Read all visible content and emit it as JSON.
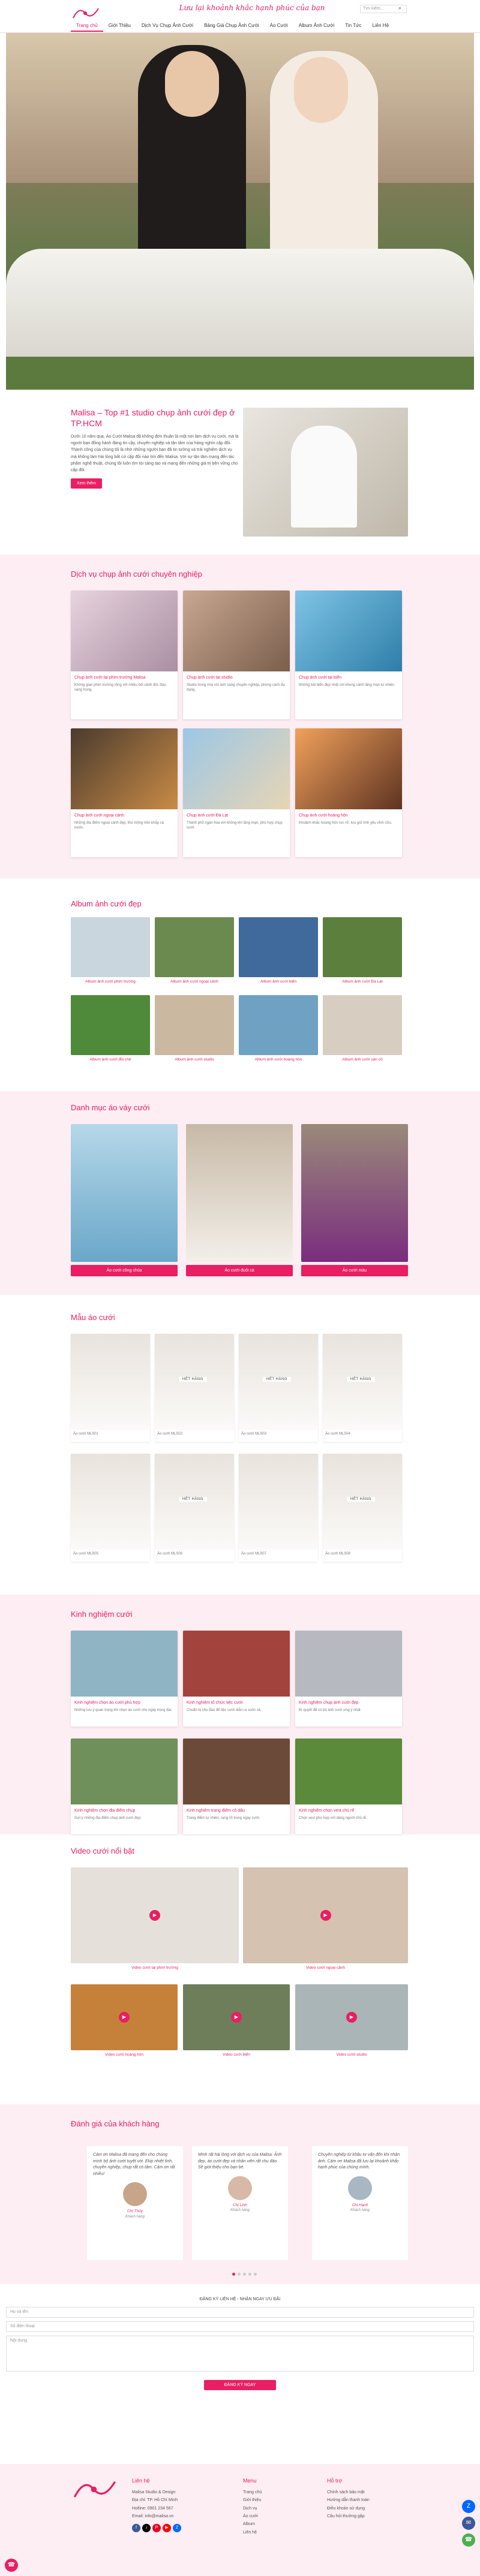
{
  "header": {
    "logo_text": "Malisa",
    "slogan": "Lưu lại khoảnh khắc hạnh phúc của bạn",
    "search_placeholder": "Tìm kiếm...",
    "nav": [
      "Trang chủ",
      "Giới Thiệu",
      "Dịch Vụ Chụp Ảnh Cưới",
      "Bảng Giá Chụp Ảnh Cưới",
      "Áo Cưới",
      "Album Ảnh Cưới",
      "Tin Tức",
      "Liên Hệ"
    ]
  },
  "intro": {
    "title": "Malisa – Top #1 studio chụp ảnh cưới đẹp ở TP.HCM",
    "text": "Dưới 10 năm qua, Áo Cưới Malisa đã không đơn thuần là một nơi làm dịch vụ cưới, mà là người bạn đồng hành đáng tin cậy, chuyên nghiệp và tận tâm của hàng nghìn cặp đôi. Thành công của chúng tôi là nhờ những người bạn đã tin tưởng và trải nghiệm dịch vụ mà không làm hài lòng bất cứ cặp đôi nào tìm đến Malisa. Với sự tận tâm mang đến tác phẩm nghệ thuật, chúng tôi luôn tìm tòi sáng tạo và mang đến những giá trị bền vững cho cặp đôi.",
    "button": "Xem thêm"
  },
  "services": {
    "title": "Dịch vụ chụp ảnh cưới chuyên nghiệp",
    "items": [
      {
        "title": "Chụp ảnh cưới tại phim trường Malisa",
        "desc": "Không gian phim trường rộng với nhiều bối cảnh độc đáo, sang trọng."
      },
      {
        "title": "Chụp ảnh cưới tại studio",
        "desc": "Studio trong nhà với ánh sáng chuyên nghiệp, phong cách đa dạng."
      },
      {
        "title": "Chụp ảnh cưới tại biển",
        "desc": "Những bãi biển đẹp nhất với khung cảnh lãng mạn tự nhiên."
      },
      {
        "title": "Chụp ảnh cưới ngoại cảnh",
        "desc": "Những địa điểm ngoại cảnh đẹp, thơ mộng trên khắp cả nước."
      },
      {
        "title": "Chụp ảnh cưới Đà Lạt",
        "desc": "Thành phố ngàn hoa với không khí lãng mạn, phù hợp chụp cưới."
      },
      {
        "title": "Chụp ảnh cưới hoàng hôn",
        "desc": "Khoảnh khắc hoàng hôn rực rỡ, lưu giữ tình yêu vĩnh cửu."
      }
    ]
  },
  "albums": {
    "title": "Album ảnh cưới đẹp",
    "items": [
      "Album ảnh cưới phim trường",
      "Album ảnh cưới ngoại cảnh",
      "Album ảnh cưới biển",
      "Album ảnh cưới Đà Lạt",
      "Album ảnh cưới đồi chè",
      "Album ảnh cưới studio",
      "Album ảnh cưới hoàng hôn",
      "Album ảnh cưới sân cỏ"
    ]
  },
  "dress_categories": {
    "title": "Danh mục áo váy cưới",
    "items": [
      "Áo cưới công chúa",
      "Áo cưới đuôi cá",
      "Áo cưới màu"
    ]
  },
  "dresses": {
    "title": "Mẫu áo cưới",
    "sold_label": "HẾT HÀNG",
    "items": [
      "Áo cưới MLS01",
      "Áo cưới MLS02",
      "Áo cưới MLS03",
      "Áo cưới MLS04",
      "Áo cưới MLS05",
      "Áo cưới MLS06",
      "Áo cưới MLS07",
      "Áo cưới MLS08"
    ]
  },
  "experience": {
    "title": "Kinh nghiệm cưới",
    "items": [
      {
        "title": "Kinh nghiệm chọn áo cưới phù hợp",
        "desc": "Những lưu ý quan trọng khi chọn áo cưới cho ngày trọng đại."
      },
      {
        "title": "Kinh nghiệm tổ chức tiệc cưới",
        "desc": "Chuẩn bị chu đáo để tiệc cưới diễn ra suôn sẻ."
      },
      {
        "title": "Kinh nghiệm chụp ảnh cưới đẹp",
        "desc": "Bí quyết để có bộ ảnh cưới ưng ý nhất."
      },
      {
        "title": "Kinh nghiệm chọn địa điểm chụp",
        "desc": "Gợi ý những địa điểm chụp ảnh cưới đẹp."
      },
      {
        "title": "Kinh nghiệm trang điểm cô dâu",
        "desc": "Trang điểm tự nhiên, rạng rỡ trong ngày cưới."
      },
      {
        "title": "Kinh nghiệm chọn vest chú rể",
        "desc": "Chọn vest phù hợp với dáng người chú rể."
      }
    ]
  },
  "videos": {
    "title": "Video cưới nổi bật",
    "items": [
      "Video cưới tại phim trường",
      "Video cưới ngoại cảnh",
      "Video cưới hoàng hôn",
      "Video cưới biển",
      "Video cưới studio"
    ]
  },
  "reviews": {
    "title": "Đánh giá của khách hàng",
    "items": [
      {
        "text": "Cảm ơn Malisa đã mang đến cho chúng mình bộ ảnh cưới tuyệt vời. Ekip nhiệt tình, chuyên nghiệp, chụp rất có tâm. Cảm ơn rất nhiều!",
        "name": "Chị Thủy",
        "role": "Khách hàng"
      },
      {
        "text": "Mình rất hài lòng với dịch vụ của Malisa. Ảnh đẹp, áo cưới đẹp và nhân viên rất chu đáo. Sẽ giới thiệu cho bạn bè.",
        "name": "Chị Linh",
        "role": "Khách hàng"
      },
      {
        "text": "Chuyên nghiệp từ khâu tư vấn đến khi nhận ảnh. Cảm ơn Malisa đã lưu lại khoảnh khắc hạnh phúc của chúng mình.",
        "name": "Chị Hạnh",
        "role": "Khách hàng"
      }
    ]
  },
  "form": {
    "title": "ĐĂNG KÝ LIÊN HỆ - NHẬN NGAY ƯU ĐÃI",
    "name_placeholder": "Họ và tên",
    "phone_placeholder": "Số điện thoại",
    "message_placeholder": "Nội dung",
    "submit": "ĐĂNG KÝ NGAY"
  },
  "footer": {
    "contact_title": "Liên hệ",
    "contact": [
      "Malisa Studio & Design",
      "Địa chỉ: TP. Hồ Chí Minh",
      "Hotline: 0901 234 567",
      "Email: info@malisa.vn"
    ],
    "menu_title": "Menu",
    "menu": [
      "Trang chủ",
      "Giới thiệu",
      "Dịch vụ",
      "Áo cưới",
      "Album",
      "Liên hệ"
    ],
    "about_title": "Hỗ trợ",
    "about": [
      "Chính sách bảo mật",
      "Hướng dẫn thanh toán",
      "Điều khoản sử dụng",
      "Câu hỏi thường gặp"
    ]
  }
}
